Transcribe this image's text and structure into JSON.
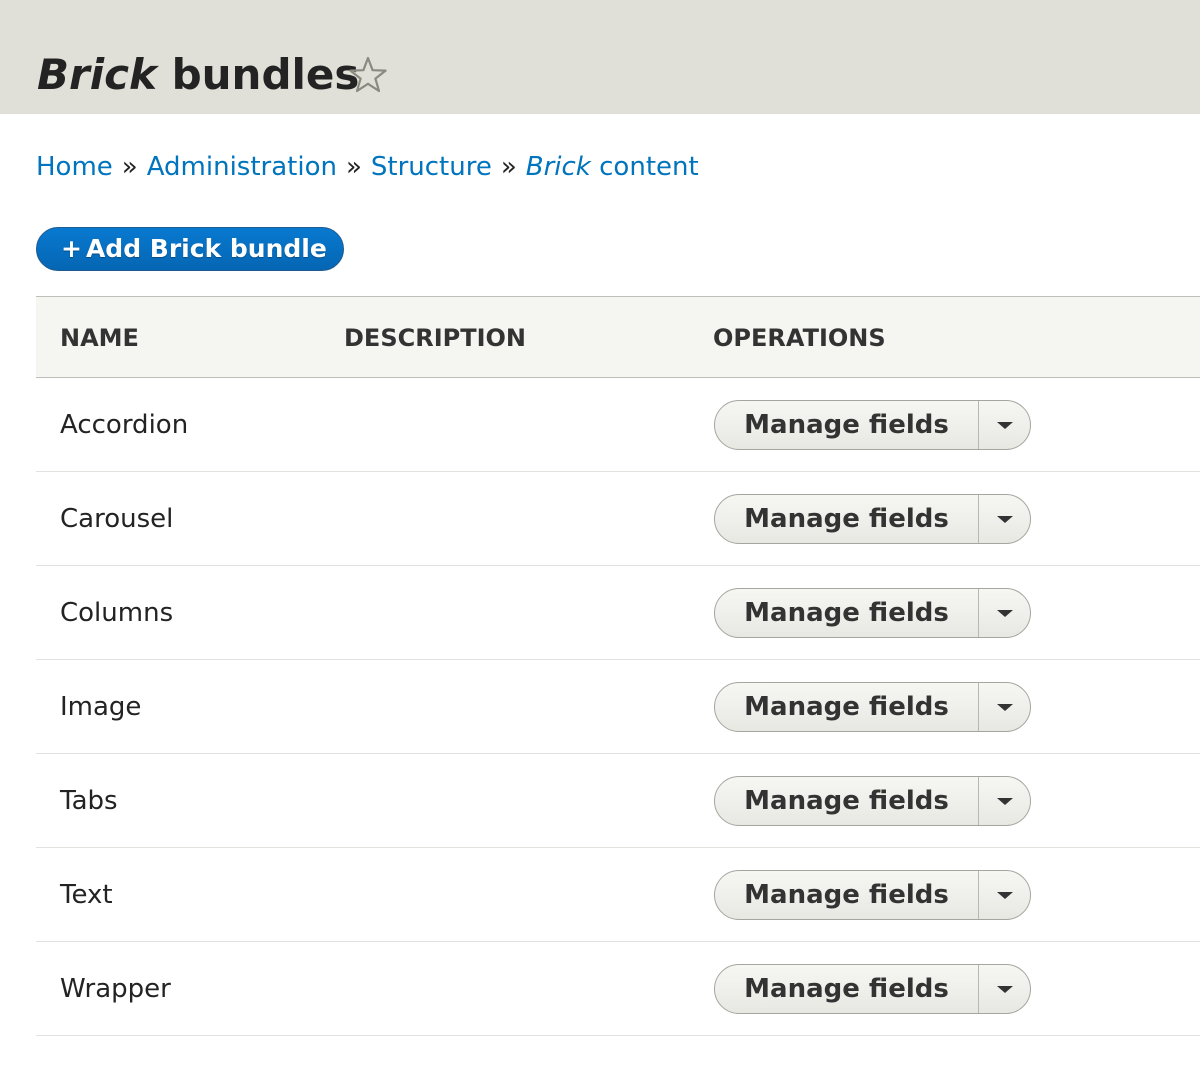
{
  "header": {
    "title_italic": "Brick",
    "title_rest": "bundles",
    "shortcut_icon": "star-outline-icon"
  },
  "breadcrumb": {
    "items": [
      {
        "label": "Home"
      },
      {
        "label": "Administration"
      },
      {
        "label": "Structure"
      },
      {
        "label_italic": "Brick",
        "label_rest": "content"
      }
    ],
    "separator": "»"
  },
  "actions": {
    "add_icon": "+",
    "add_label": "Add Brick bundle"
  },
  "table": {
    "columns": [
      "Name",
      "Description",
      "Operations"
    ],
    "rows": [
      {
        "name": "Accordion",
        "description": "",
        "operation": "Manage fields"
      },
      {
        "name": "Carousel",
        "description": "",
        "operation": "Manage fields"
      },
      {
        "name": "Columns",
        "description": "",
        "operation": "Manage fields"
      },
      {
        "name": "Image",
        "description": "",
        "operation": "Manage fields"
      },
      {
        "name": "Tabs",
        "description": "",
        "operation": "Manage fields"
      },
      {
        "name": "Text",
        "description": "",
        "operation": "Manage fields"
      },
      {
        "name": "Wrapper",
        "description": "",
        "operation": "Manage fields"
      }
    ]
  },
  "colors": {
    "header_bg": "#e0e0d8",
    "link": "#0074bd",
    "primary_button": "#0566b3"
  }
}
